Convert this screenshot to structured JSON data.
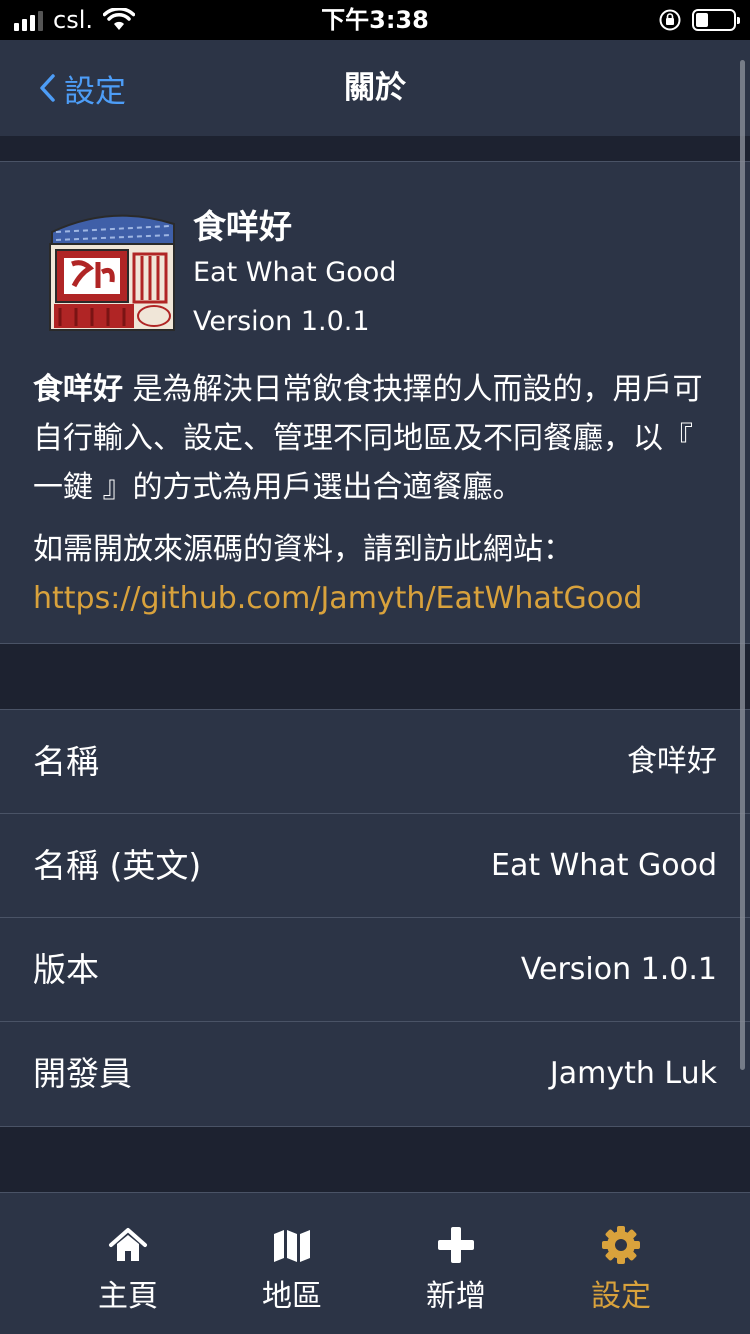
{
  "status_bar": {
    "carrier": "csl.",
    "time": "下午3:38"
  },
  "nav": {
    "back_label": "設定",
    "title": "關於"
  },
  "app": {
    "name": "食咩好",
    "name_en": "Eat What Good",
    "version": "Version 1.0.1"
  },
  "description": {
    "bold": "食咩好",
    "text": " 是為解決日常飲食抉擇的人而設的，用戶可自行輸入、設定、管理不同地區及不同餐廳，以『 一鍵 』的方式為用戶選出合適餐廳。"
  },
  "source": {
    "prefix": "如需開放來源碼的資料，請到訪此網站：",
    "link": "https://github.com/Jamyth/EatWhatGood"
  },
  "info_rows": [
    {
      "label": "名稱",
      "value": "食咩好"
    },
    {
      "label": "名稱 (英文)",
      "value": "Eat What Good"
    },
    {
      "label": "版本",
      "value": "Version 1.0.1"
    },
    {
      "label": "開發員",
      "value": "Jamyth Luk"
    }
  ],
  "tabs": [
    {
      "label": "主頁",
      "icon": "home-icon"
    },
    {
      "label": "地區",
      "icon": "map-icon"
    },
    {
      "label": "新增",
      "icon": "plus-icon"
    },
    {
      "label": "設定",
      "icon": "gear-icon"
    }
  ],
  "colors": {
    "background": "#1d2230",
    "surface": "#2c3446",
    "accent": "#d9a23c",
    "back_link": "#4d9df7"
  }
}
